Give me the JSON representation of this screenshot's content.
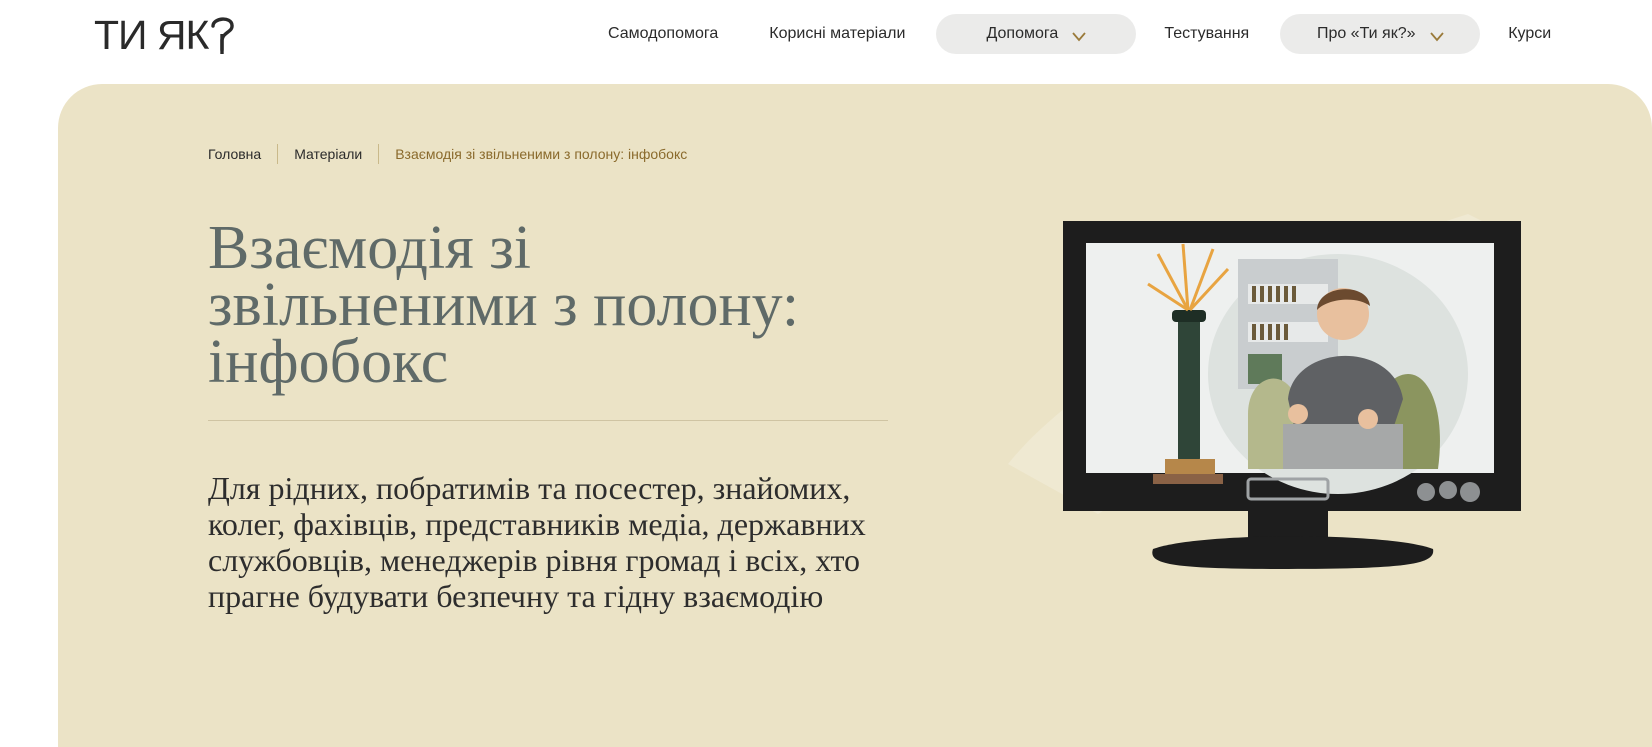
{
  "header": {
    "logo_text": "ТИ ЯК",
    "nav": [
      {
        "label": "Самодопомога"
      },
      {
        "label": "Корисні матеріали"
      },
      {
        "label": "Допомога"
      },
      {
        "label": "Тестування"
      },
      {
        "label": "Про «Ти як?»"
      },
      {
        "label": "Курси"
      }
    ]
  },
  "breadcrumb": {
    "items": [
      "Головна",
      "Матеріали"
    ],
    "current": "Взаємодія зі звільненими з полону: інфобокс"
  },
  "page": {
    "title": "Взаємодія зі звільненими з полону: інфобокс",
    "subtitle": "Для рідних, побратимів та посестер, знайомих, колег, фахівців, представників медіа, державних службовців, менеджерів рівня громад і всіх, хто прагне будувати безпечну та гідну взаємодію"
  },
  "colors": {
    "hero_bg": "#ebe3c6",
    "pill_bg": "#ebebea",
    "title": "#5f6a68",
    "breadcrumb_current": "#8a6a2c",
    "chevron": "#9a7a3a"
  },
  "icons": {
    "logo_mark": "question-mark-icon",
    "dropdown": "chevron-down-icon",
    "illustration": "tv-with-man-on-sofa"
  }
}
